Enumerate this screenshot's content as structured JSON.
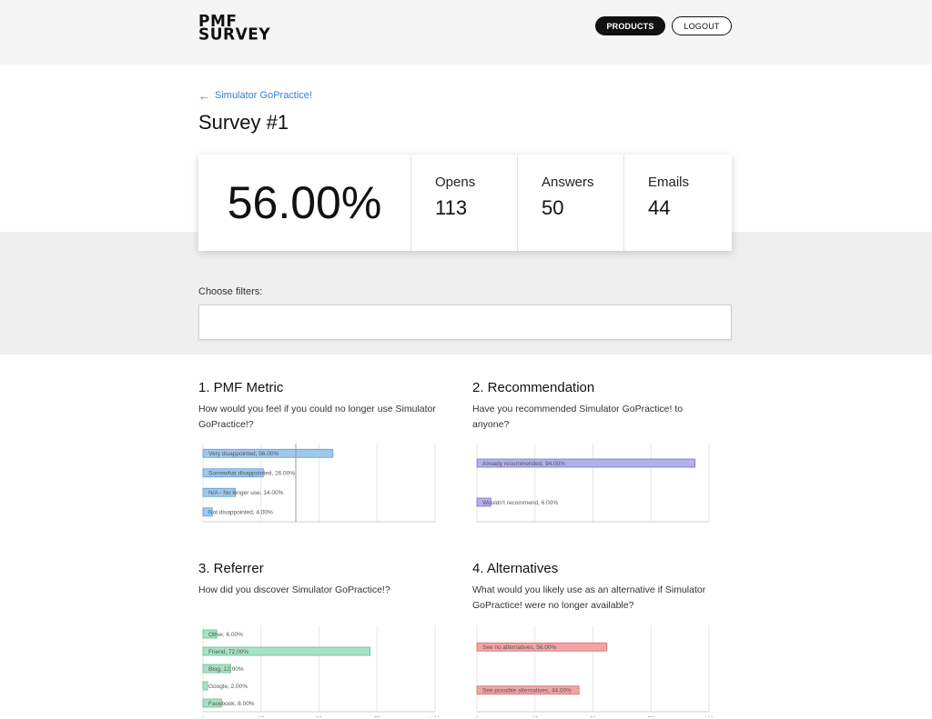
{
  "header": {
    "logo_line1": "PMF",
    "logo_line2": "SURVEY",
    "products_label": "PRODUCTS",
    "logout_label": "LOGOUT"
  },
  "breadcrumb": {
    "back_label": "Simulator GoPractice!"
  },
  "page_title": "Survey #1",
  "stats": {
    "score": "56.00%",
    "opens_label": "Opens",
    "opens_value": "113",
    "answers_label": "Answers",
    "answers_value": "50",
    "emails_label": "Emails",
    "emails_value": "44"
  },
  "filters": {
    "label": "Choose filters:",
    "value": ""
  },
  "sections": [
    {
      "title": "1. PMF Metric",
      "question": "How would you feel if you could no longer use Simulator GoPractice!?"
    },
    {
      "title": "2. Recommendation",
      "question": "Have you recommended Simulator GoPractice! to anyone?"
    },
    {
      "title": "3. Referrer",
      "question": "How did you discover Simulator GoPractice!?"
    },
    {
      "title": "4. Alternatives",
      "question": "What would you likely use as an alternative if Simulator GoPractice! were no longer available?"
    }
  ],
  "chart_data": [
    {
      "type": "bar",
      "orientation": "horizontal",
      "categories": [
        "Very disappointed",
        "Somewhat disappointed",
        "N/A - No longer use",
        "Not disappointed"
      ],
      "values": [
        56,
        26,
        14,
        4
      ],
      "bar_labels": [
        "Very disappointed, 56.00%",
        "Somewhat disappointed, 26.00%",
        "N/A - No longer use, 14.00%",
        "Not disappointed, 4.00%"
      ],
      "xlim": [
        0,
        100
      ],
      "x_ticks": [
        "0",
        "25",
        "50",
        "75",
        "100"
      ],
      "reference_line": 40,
      "color": "#9ec8ec",
      "stroke": "#5a9fd8",
      "grid": true
    },
    {
      "type": "bar",
      "orientation": "horizontal",
      "categories": [
        "Already recommended",
        "Wouldn't recommend"
      ],
      "values": [
        94,
        6
      ],
      "bar_labels": [
        "Already recommended, 94.00%",
        "Wouldn't recommend, 6.00%"
      ],
      "xlim": [
        0,
        100
      ],
      "x_ticks": [
        "0",
        "25",
        "50",
        "75",
        "100"
      ],
      "color": "#b3b0ea",
      "stroke": "#7a74d2",
      "grid": true
    },
    {
      "type": "bar",
      "orientation": "horizontal",
      "categories": [
        "Other",
        "Friend",
        "Blog",
        "Google",
        "Facebook"
      ],
      "values": [
        6,
        72,
        12,
        2,
        8
      ],
      "bar_labels": [
        "Other, 6.00%",
        "Friend, 72.00%",
        "Blog, 12.00%",
        "Google, 2.00%",
        "Facebook, 8.00%"
      ],
      "xlim": [
        0,
        100
      ],
      "x_ticks": [
        "0",
        "25",
        "50",
        "75",
        "100"
      ],
      "color": "#a8e2c4",
      "stroke": "#5cc495",
      "grid": true
    },
    {
      "type": "bar",
      "orientation": "horizontal",
      "categories": [
        "See no alternatives",
        "See possible alternatives"
      ],
      "values": [
        56,
        44
      ],
      "bar_labels": [
        "See no alternatives, 56.00%",
        "See possible alternatives, 44.00%"
      ],
      "xlim": [
        0,
        100
      ],
      "x_ticks": [
        "0",
        "25",
        "50",
        "75",
        "100"
      ],
      "color": "#f2a4a4",
      "stroke": "#dc6a6a",
      "grid": true
    }
  ]
}
